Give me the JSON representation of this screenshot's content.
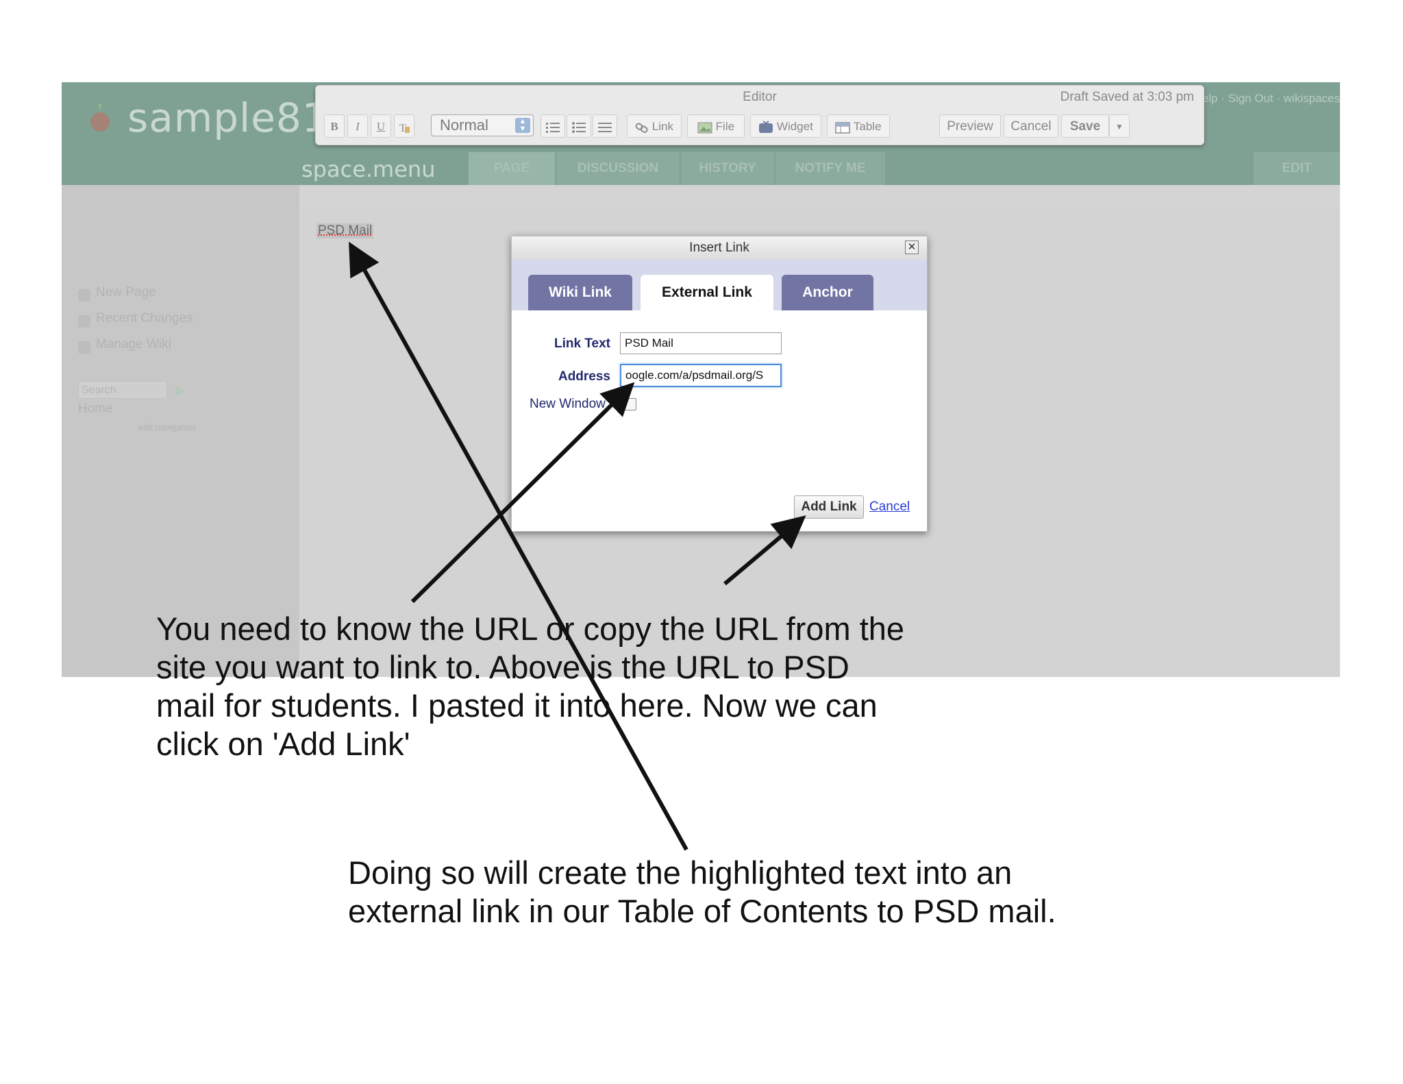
{
  "site": {
    "logo_text": "sample81",
    "top_links": "· Help · Sign Out · wikispaces",
    "space_menu": "space.menu",
    "nav_tabs": [
      "PAGE",
      "DISCUSSION",
      "HISTORY",
      "NOTIFY ME",
      "EDIT"
    ]
  },
  "sidebar": {
    "items": [
      {
        "label": "New Page",
        "icon": "new-page-icon"
      },
      {
        "label": "Recent Changes",
        "icon": "calendar-icon"
      },
      {
        "label": "Manage Wiki",
        "icon": "wrench-icon"
      }
    ],
    "search_placeholder": "Search",
    "home_label": "Home",
    "sub_label": "edit navigation"
  },
  "editor": {
    "title": "Editor",
    "draft_status": "Draft Saved at 3:03 pm",
    "format_value": "Normal",
    "bold": "B",
    "italic": "I",
    "underline": "U",
    "link_label": "Link",
    "file_label": "File",
    "widget_label": "Widget",
    "table_label": "Table",
    "preview_label": "Preview",
    "cancel_label": "Cancel",
    "save_label": "Save"
  },
  "page": {
    "highlighted_text": "PSD Mail"
  },
  "dialog": {
    "title": "Insert Link",
    "tabs": [
      "Wiki Link",
      "External Link",
      "Anchor"
    ],
    "active_tab": "External Link",
    "link_text_label": "Link Text",
    "link_text_value": "PSD Mail",
    "address_label": "Address",
    "address_value": "oogle.com/a/psdmail.org/S",
    "new_window_label": "New Window",
    "add_link_label": "Add Link",
    "cancel_label": "Cancel"
  },
  "annotations": {
    "note1": "You need to know the URL or copy the URL from the\nsite you want to link to.  Above is the URL to PSD\nmail for students.  I pasted it into here.  Now we can\nclick on 'Add Link'",
    "note2": "Doing so will create the highlighted text into an\nexternal link in our Table of Contents to PSD mail."
  },
  "colors": {
    "header_green": "#7fa193",
    "tab_purple": "#7274a4",
    "label_navy": "#21286e",
    "focus_blue": "#4f8fdb"
  }
}
